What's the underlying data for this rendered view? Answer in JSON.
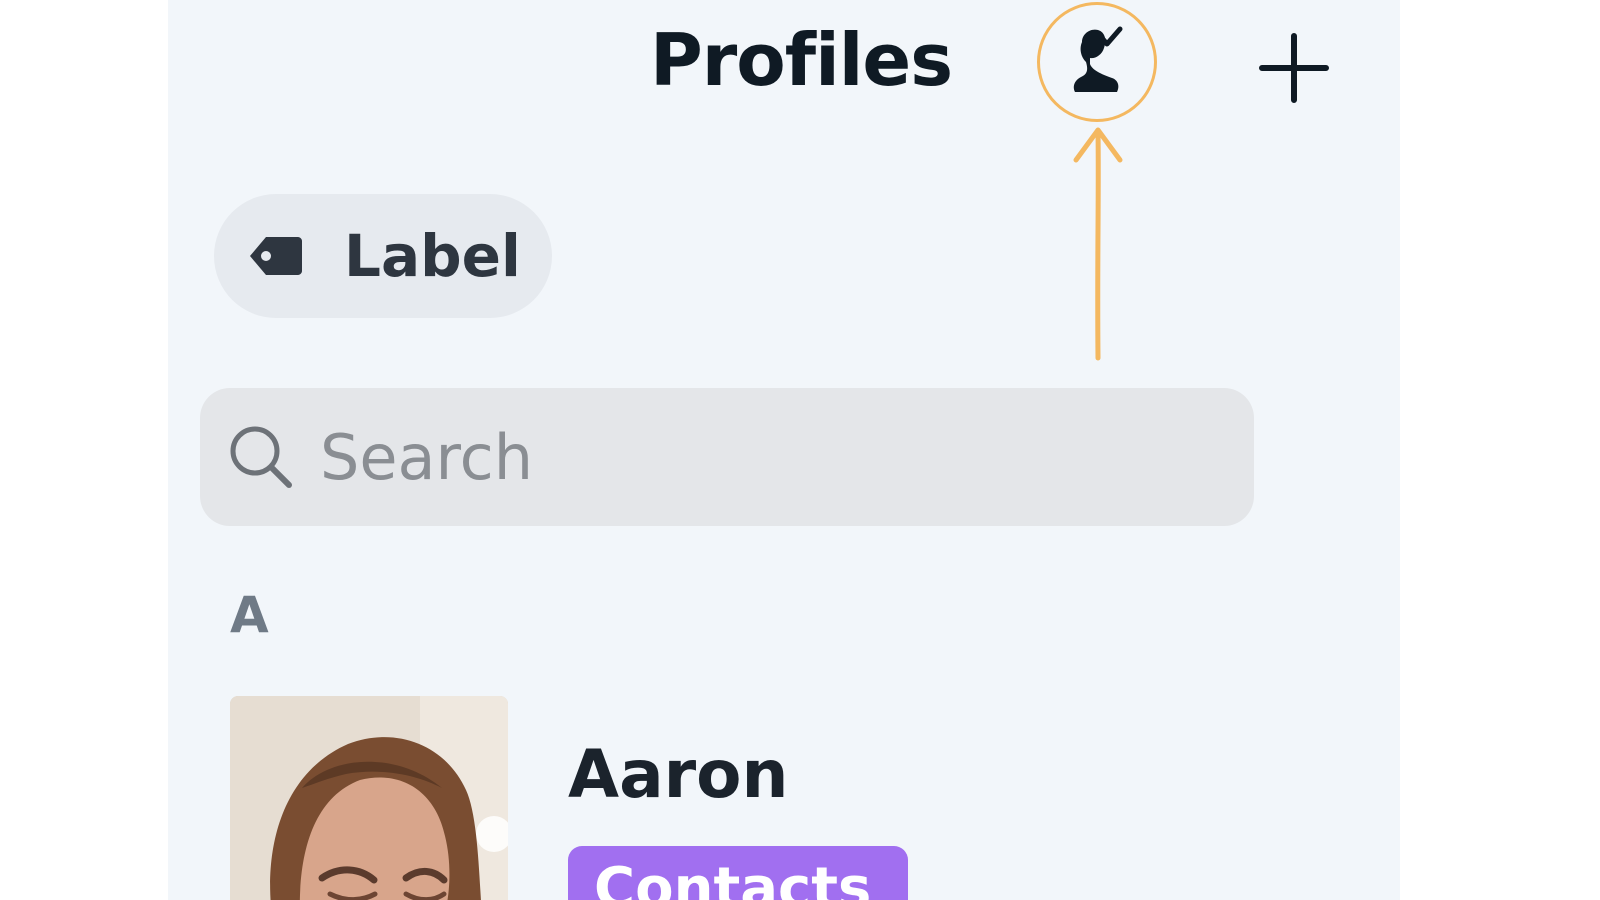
{
  "header": {
    "title": "Profiles",
    "profile_filter_icon": "person-check-icon",
    "add_icon": "plus-icon"
  },
  "annotation": {
    "color": "#f4b860",
    "icon": "arrow-up-icon"
  },
  "label_chip": {
    "icon": "tag-icon",
    "text": "Label"
  },
  "search": {
    "icon": "search-icon",
    "placeholder": "Search",
    "value": ""
  },
  "contacts": {
    "section_letter": "A",
    "items": [
      {
        "name": "Aaron",
        "badge_text": "Contacts",
        "badge_color": "#a16ff0"
      }
    ]
  },
  "colors": {
    "panel_background": "#f2f6fa",
    "title": "#0f1a24",
    "chip_background": "#e6eaef",
    "search_background": "#e4e6e9"
  }
}
